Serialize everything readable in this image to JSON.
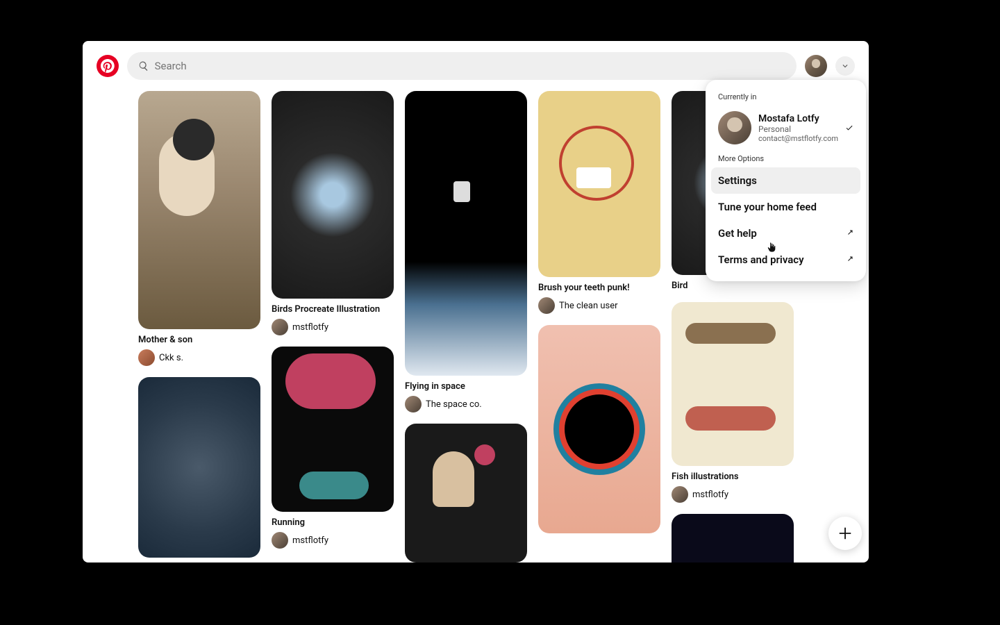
{
  "brand": {
    "name": "Pinterest",
    "color": "#e60023"
  },
  "search": {
    "placeholder": "Search"
  },
  "user": {
    "avatar_alt": "Profile avatar"
  },
  "dropdown": {
    "section_current": "Currently in",
    "account": {
      "name": "Mostafa Lotfy",
      "type": "Personal",
      "email": "contact@mstflotfy.com"
    },
    "section_more": "More Options",
    "items": [
      {
        "label": "Settings",
        "external": false,
        "hovered": true
      },
      {
        "label": "Tune your home feed",
        "external": false,
        "hovered": false
      },
      {
        "label": "Get help",
        "external": true,
        "hovered": false
      },
      {
        "label": "Terms and privacy",
        "external": true,
        "hovered": false
      }
    ]
  },
  "pins": {
    "col0": [
      {
        "title": "Mother & son",
        "author": "Ckk s.",
        "img": "mother"
      },
      {
        "title": "",
        "author": "",
        "img": "stars"
      }
    ],
    "col1": [
      {
        "title": "Birds Procreate Illustration",
        "author": "mstflotfy",
        "img": "birds"
      },
      {
        "title": "Running",
        "author": "mstflotfy",
        "img": "running"
      }
    ],
    "col2": [
      {
        "title": "Flying in space",
        "author": "The space co.",
        "img": "flying"
      },
      {
        "title": "",
        "author": "",
        "img": "man"
      }
    ],
    "col3": [
      {
        "title": "Brush your teeth punk!",
        "author": "The clean user",
        "img": "teeth"
      },
      {
        "title": "",
        "author": "",
        "img": "abstract"
      }
    ],
    "col4": [
      {
        "title": "Bird",
        "author": "",
        "img": "birds2"
      },
      {
        "title": "Fish illustrations",
        "author": "mstflotfy",
        "img": "fish"
      },
      {
        "title": "",
        "author": "",
        "img": "night"
      }
    ]
  },
  "fab": {
    "label": "Add"
  }
}
